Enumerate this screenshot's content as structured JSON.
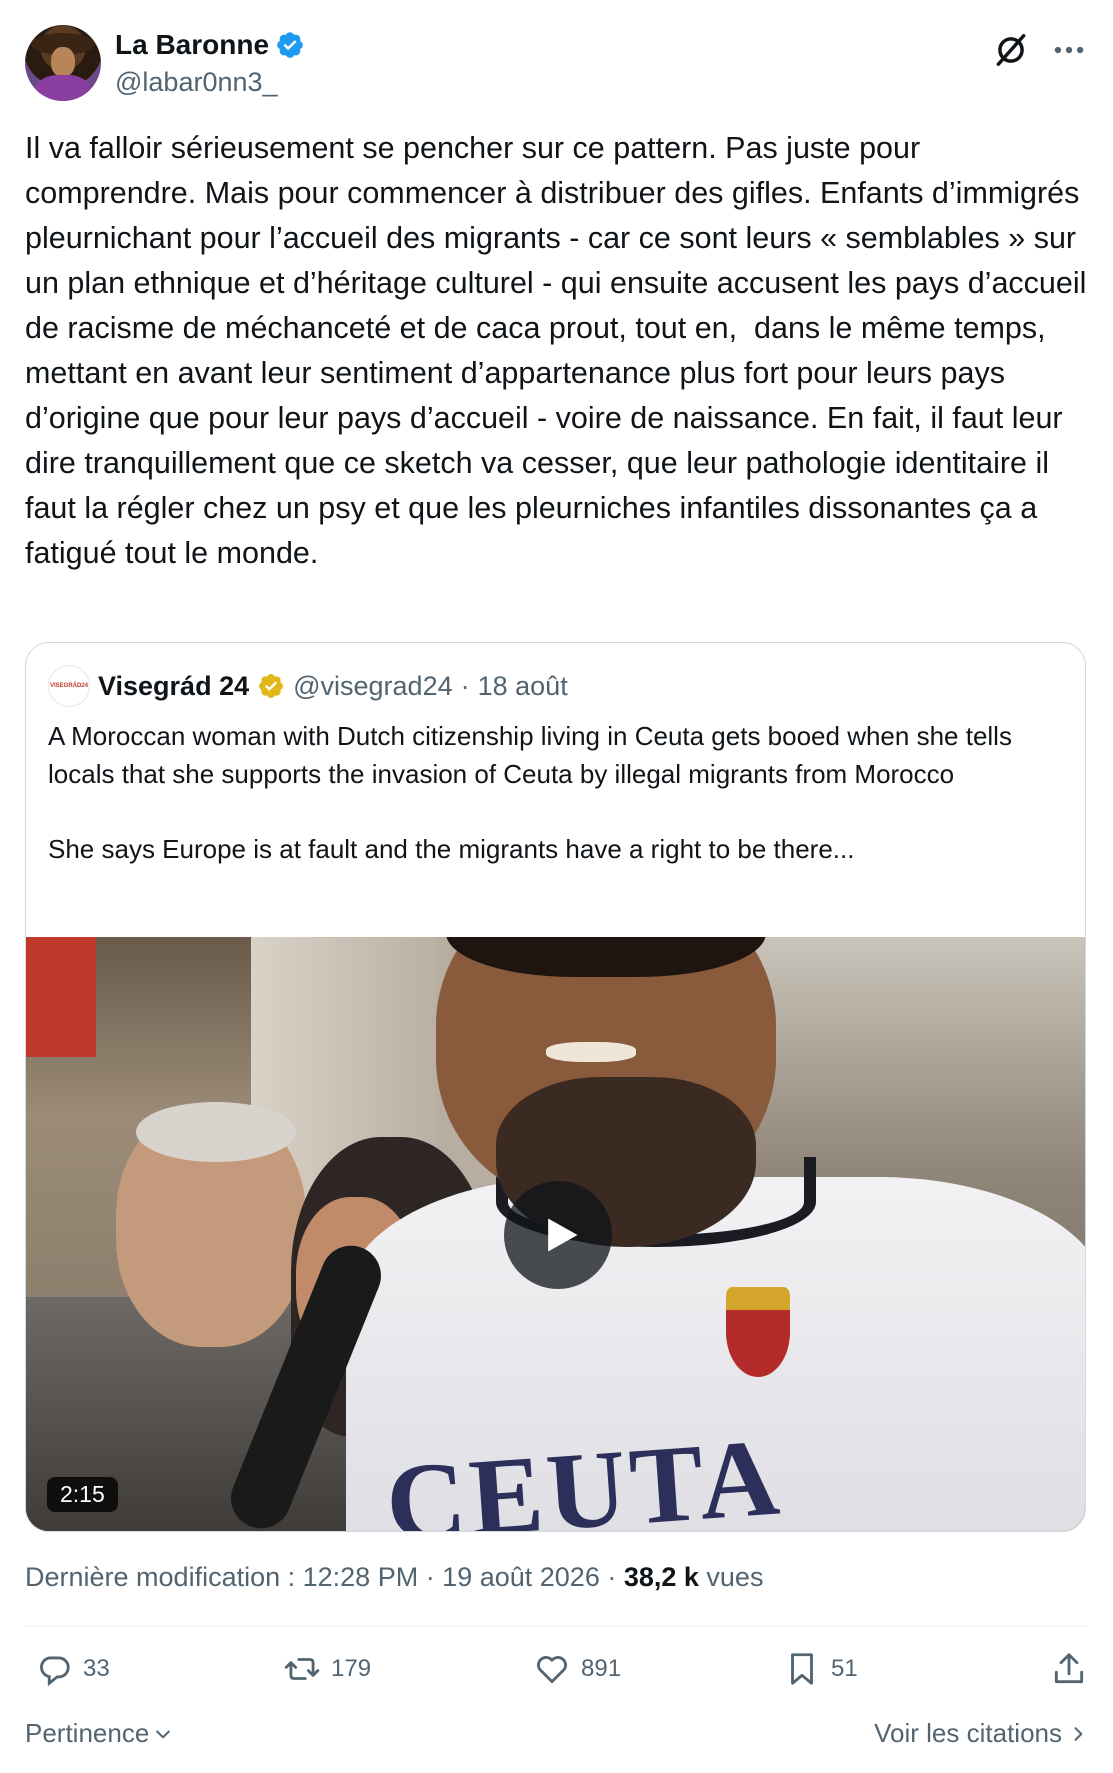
{
  "author": {
    "display_name": "La Baronne",
    "handle": "@labar0nn3_",
    "verified_color": "#1d9bf0"
  },
  "tweet": {
    "text": "Il va falloir sérieusement se pencher sur ce pattern. Pas juste pour comprendre. Mais pour commencer à distribuer des gifles. Enfants d’immigrés pleurnichant pour l’accueil des migrants - car ce sont leurs « semblables » sur un plan ethnique et d’héritage culturel - qui ensuite accusent les pays d’accueil de racisme de méchanceté et de caca prout, tout en,  dans le même temps, mettant en avant leur sentiment d’appartenance plus fort pour leurs pays d’origine que pour leur pays d’accueil - voire de naissance. En fait, il faut leur dire tranquillement que ce sketch va cesser, que leur pathologie identitaire il faut la régler chez un psy et que les pleurniches infantiles dissonantes ça a fatigué tout le monde."
  },
  "quote": {
    "avatar_text": "VISEGRÁD24",
    "display_name": "Visegrád 24",
    "verified_color": "#e2b719",
    "handle": "@visegrad24",
    "separator": "·",
    "date": "18 août",
    "text": "A Moroccan woman with Dutch citizenship living in Ceuta gets booed when she tells locals that she supports the invasion of Ceuta by illegal migrants from Morocco\n\nShe says Europe is at fault and the migrants have a right to be there...",
    "video": {
      "duration": "2:15",
      "jersey_text": "CEUTA"
    }
  },
  "meta": {
    "edited_label": "Dernière modification : 12:28 PM · 19 août 2026 · ",
    "views_count": "38,2 k",
    "views_label": " vues"
  },
  "actions": {
    "replies": "33",
    "retweets": "179",
    "likes": "891",
    "bookmarks": "51"
  },
  "footer": {
    "sort_label": "Pertinence",
    "quotes_label": "Voir les citations"
  },
  "icons": {
    "more": "more-icon",
    "grok": "grok-icon",
    "reply": "reply-icon",
    "retweet": "retweet-icon",
    "like": "heart-icon",
    "bookmark": "bookmark-icon",
    "share": "share-icon"
  }
}
